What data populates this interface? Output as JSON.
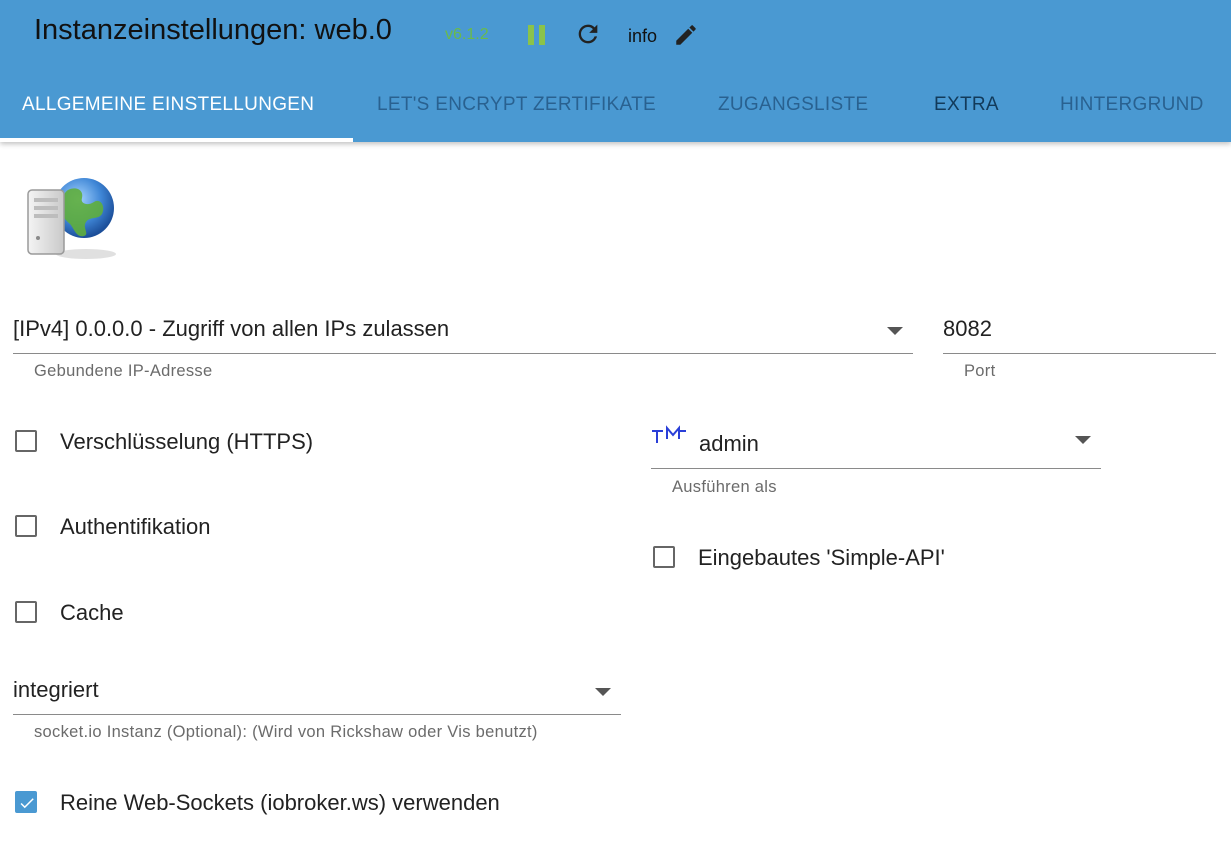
{
  "header": {
    "title": "Instanzeinstellungen: web.0",
    "version": "v6.1.2",
    "info_label": "info",
    "icons": [
      "pause-icon",
      "reload-icon",
      "edit-icon"
    ],
    "colors": {
      "bar": "#4a99d2",
      "version": "#6abb4a"
    }
  },
  "tabs": [
    {
      "label": "ALLGEMEINE EINSTELLUNGEN",
      "active": true
    },
    {
      "label": "LET'S ENCRYPT ZERTIFIKATE",
      "active": false
    },
    {
      "label": "ZUGANGSLISTE",
      "active": false
    },
    {
      "label": "EXTRA",
      "active": false
    },
    {
      "label": "HINTERGRUND",
      "active": false
    }
  ],
  "form": {
    "bind_ip": {
      "value": "[IPv4] 0.0.0.0 - Zugriff von allen IPs zulassen",
      "helper": "Gebundene IP-Adresse"
    },
    "port": {
      "value": "8082",
      "helper": "Port"
    },
    "https": {
      "label": "Verschlüsselung (HTTPS)",
      "checked": false
    },
    "auth": {
      "label": "Authentifikation",
      "checked": false
    },
    "cache": {
      "label": "Cache",
      "checked": false
    },
    "run_as": {
      "value": "admin",
      "helper": "Ausführen als"
    },
    "simple_api": {
      "label": "Eingebautes 'Simple-API'",
      "checked": false
    },
    "socketio": {
      "value": "integriert",
      "helper": "socket.io Instanz (Optional): (Wird von Rickshaw oder Vis benutzt)"
    },
    "pure_ws": {
      "label": "Reine Web-Sockets (iobroker.ws) verwenden",
      "checked": true
    }
  }
}
